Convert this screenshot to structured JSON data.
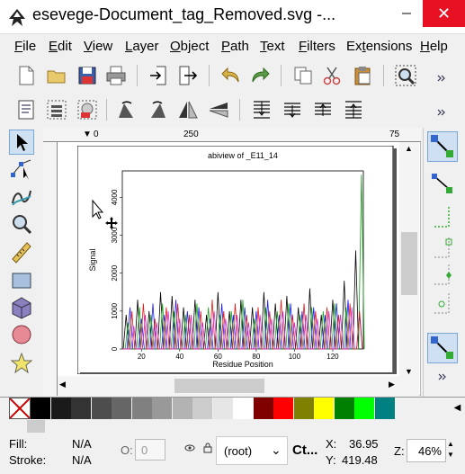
{
  "window": {
    "title": "esevege-Document_tag_Removed.svg -...",
    "close": "✕"
  },
  "menu": [
    "File",
    "Edit",
    "View",
    "Layer",
    "Object",
    "Path",
    "Text",
    "Filters",
    "Extensions",
    "Help"
  ],
  "menu_underline_index": [
    0,
    0,
    0,
    0,
    0,
    0,
    0,
    0,
    2,
    0
  ],
  "ruler": {
    "zero": "0",
    "mark_250": "250",
    "mark_75": "75"
  },
  "chart_data": {
    "type": "line",
    "title": "abiview of _E11_14",
    "xlabel": "Residue Position",
    "ylabel": "Signal",
    "xlim": [
      10,
      136
    ],
    "ylim": [
      0,
      4700
    ],
    "x_ticks": [
      20,
      40,
      60,
      80,
      100,
      120
    ],
    "y_ticks": [
      0,
      1000,
      2000,
      3000,
      4000
    ],
    "series": [
      {
        "color": "#000000",
        "x": [
          12,
          18,
          24,
          30,
          36,
          42,
          48,
          54,
          60,
          66,
          72,
          78,
          84,
          90,
          96,
          102,
          108,
          114,
          120,
          126,
          132
        ],
        "values": [
          900,
          1300,
          1000,
          1500,
          1400,
          1100,
          1300,
          900,
          1500,
          1000,
          1300,
          1100,
          1500,
          1200,
          1400,
          1100,
          1600,
          900,
          1300,
          1800,
          2600
        ]
      },
      {
        "color": "#1a1aff",
        "x": [
          14,
          20,
          26,
          32,
          38,
          44,
          50,
          56,
          62,
          68,
          74,
          80,
          86,
          92,
          98,
          104,
          110,
          116,
          122,
          128,
          134
        ],
        "values": [
          1100,
          800,
          1200,
          900,
          1300,
          1000,
          1100,
          800,
          1200,
          900,
          1100,
          1000,
          1300,
          900,
          1200,
          1000,
          1100,
          900,
          1200,
          1300,
          900
        ]
      },
      {
        "color": "#1aa31a",
        "x": [
          13,
          19,
          25,
          31,
          37,
          43,
          49,
          55,
          61,
          67,
          73,
          79,
          85,
          91,
          97,
          103,
          109,
          115,
          121,
          127,
          135
        ],
        "values": [
          700,
          1100,
          900,
          1200,
          1000,
          900,
          1200,
          1100,
          900,
          1000,
          1300,
          800,
          1100,
          1000,
          1200,
          900,
          1100,
          1000,
          1200,
          1100,
          4600
        ]
      },
      {
        "color": "#e01a1a",
        "x": [
          15,
          21,
          27,
          33,
          39,
          45,
          51,
          57,
          63,
          69,
          75,
          81,
          87,
          93,
          99,
          105,
          111,
          117,
          123,
          129,
          134
        ],
        "values": [
          1000,
          1200,
          800,
          1100,
          1200,
          900,
          1000,
          1300,
          1000,
          1200,
          900,
          1100,
          1000,
          1300,
          900,
          1200,
          1000,
          1100,
          900,
          1200,
          1000
        ]
      },
      {
        "color": "#cc33cc",
        "x": [
          16,
          22,
          28,
          34,
          40,
          46,
          52,
          58,
          64,
          70,
          76,
          82,
          88,
          94,
          100,
          106,
          112,
          118,
          124,
          130
        ],
        "values": [
          600,
          900,
          700,
          1000,
          800,
          900,
          700,
          1000,
          800,
          900,
          700,
          900,
          800,
          1000,
          700,
          900,
          800,
          1000,
          900,
          1100
        ]
      }
    ]
  },
  "palette": {
    "colors": [
      "#000000",
      "#1a1a1a",
      "#333333",
      "#4d4d4d",
      "#666666",
      "#808080",
      "#999999",
      "#b3b3b3",
      "#cccccc",
      "#e6e6e6",
      "#ffffff",
      "#800000",
      "#ff0000",
      "#808000",
      "#ffff00",
      "#008000",
      "#00ff00",
      "#008080"
    ]
  },
  "status": {
    "fill_label": "Fill:",
    "fill_value": "N/A",
    "stroke_label": "Stroke:",
    "stroke_value": "N/A",
    "opacity_label": "O:",
    "opacity_value": "0",
    "layer_value": "(root)",
    "ctrl_hint": "Ct...",
    "x_label": "X:",
    "x_value": "36.95",
    "y_label": "Y:",
    "y_value": "419.48",
    "zoom_label": "Z:",
    "zoom_value": "46%"
  }
}
